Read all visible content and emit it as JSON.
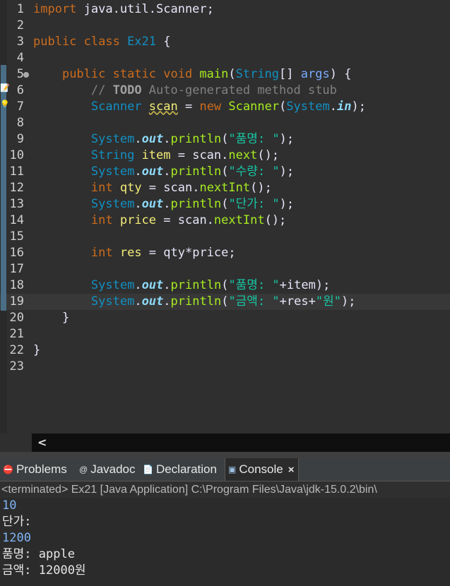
{
  "editor": {
    "lines": [
      {
        "n": "1",
        "t": [
          [
            "kw",
            "import"
          ],
          [
            "plain",
            " java.util.Scanner;"
          ]
        ]
      },
      {
        "n": "2",
        "t": []
      },
      {
        "n": "3",
        "t": [
          [
            "kw",
            "public class "
          ],
          [
            "cls",
            "Ex21"
          ],
          [
            "plain",
            " {"
          ]
        ]
      },
      {
        "n": "4",
        "t": []
      },
      {
        "n": "5",
        "t": [
          [
            "plain",
            "    "
          ],
          [
            "kw",
            "public static void "
          ],
          [
            "fn",
            "main"
          ],
          [
            "plain",
            "("
          ],
          [
            "cls",
            "String"
          ],
          [
            "plain",
            "[] "
          ],
          [
            "param",
            "args"
          ],
          [
            "plain",
            ") {"
          ]
        ]
      },
      {
        "n": "6",
        "t": [
          [
            "plain",
            "        "
          ],
          [
            "cmt",
            "// "
          ],
          [
            "todo",
            "TODO"
          ],
          [
            "cmt",
            " Auto-generated method stub"
          ]
        ]
      },
      {
        "n": "7",
        "t": [
          [
            "plain",
            "        "
          ],
          [
            "cls",
            "Scanner "
          ],
          [
            "varw",
            "scan"
          ],
          [
            "plain",
            " = "
          ],
          [
            "kw",
            "new "
          ],
          [
            "fn",
            "Scanner"
          ],
          [
            "plain",
            "("
          ],
          [
            "cls",
            "System"
          ],
          [
            "plain",
            "."
          ],
          [
            "fld",
            "in"
          ],
          [
            "plain",
            ");"
          ]
        ]
      },
      {
        "n": "8",
        "t": []
      },
      {
        "n": "9",
        "t": [
          [
            "plain",
            "        "
          ],
          [
            "cls",
            "System"
          ],
          [
            "plain",
            "."
          ],
          [
            "fld",
            "out"
          ],
          [
            "plain",
            "."
          ],
          [
            "fn",
            "println"
          ],
          [
            "plain",
            "("
          ],
          [
            "str",
            "\"품명: \""
          ],
          [
            "plain",
            ");"
          ]
        ]
      },
      {
        "n": "10",
        "t": [
          [
            "plain",
            "        "
          ],
          [
            "cls",
            "String "
          ],
          [
            "var",
            "item"
          ],
          [
            "plain",
            " = scan."
          ],
          [
            "fn",
            "next"
          ],
          [
            "plain",
            "();"
          ]
        ]
      },
      {
        "n": "11",
        "t": [
          [
            "plain",
            "        "
          ],
          [
            "cls",
            "System"
          ],
          [
            "plain",
            "."
          ],
          [
            "fld",
            "out"
          ],
          [
            "plain",
            "."
          ],
          [
            "fn",
            "println"
          ],
          [
            "plain",
            "("
          ],
          [
            "str",
            "\"수량: \""
          ],
          [
            "plain",
            ");"
          ]
        ]
      },
      {
        "n": "12",
        "t": [
          [
            "plain",
            "        "
          ],
          [
            "kw",
            "int "
          ],
          [
            "var",
            "qty"
          ],
          [
            "plain",
            " = scan."
          ],
          [
            "fn",
            "nextInt"
          ],
          [
            "plain",
            "();"
          ]
        ]
      },
      {
        "n": "13",
        "t": [
          [
            "plain",
            "        "
          ],
          [
            "cls",
            "System"
          ],
          [
            "plain",
            "."
          ],
          [
            "fld",
            "out"
          ],
          [
            "plain",
            "."
          ],
          [
            "fn",
            "println"
          ],
          [
            "plain",
            "("
          ],
          [
            "str",
            "\"단가: \""
          ],
          [
            "plain",
            ");"
          ]
        ]
      },
      {
        "n": "14",
        "t": [
          [
            "plain",
            "        "
          ],
          [
            "kw",
            "int "
          ],
          [
            "var",
            "price"
          ],
          [
            "plain",
            " = scan."
          ],
          [
            "fn",
            "nextInt"
          ],
          [
            "plain",
            "();"
          ]
        ]
      },
      {
        "n": "15",
        "t": []
      },
      {
        "n": "16",
        "t": [
          [
            "plain",
            "        "
          ],
          [
            "kw",
            "int "
          ],
          [
            "var",
            "res"
          ],
          [
            "plain",
            " = qty*price;"
          ]
        ]
      },
      {
        "n": "17",
        "t": []
      },
      {
        "n": "18",
        "t": [
          [
            "plain",
            "        "
          ],
          [
            "cls",
            "System"
          ],
          [
            "plain",
            "."
          ],
          [
            "fld",
            "out"
          ],
          [
            "plain",
            "."
          ],
          [
            "fn",
            "println"
          ],
          [
            "plain",
            "("
          ],
          [
            "str",
            "\"품명: \""
          ],
          [
            "plain",
            "+item);"
          ]
        ]
      },
      {
        "n": "19",
        "t": [
          [
            "plain",
            "        "
          ],
          [
            "cls",
            "System"
          ],
          [
            "plain",
            "."
          ],
          [
            "fld",
            "out"
          ],
          [
            "plain",
            "."
          ],
          [
            "fn",
            "println"
          ],
          [
            "plain",
            "("
          ],
          [
            "str",
            "\"금액: \""
          ],
          [
            "plain",
            "+res+"
          ],
          [
            "str",
            "\"원\""
          ],
          [
            "plain",
            ");"
          ]
        ]
      },
      {
        "n": "20",
        "t": [
          [
            "plain",
            "    }"
          ]
        ]
      },
      {
        "n": "21",
        "t": []
      },
      {
        "n": "22",
        "t": [
          [
            "plain",
            "}"
          ]
        ]
      },
      {
        "n": "23",
        "t": []
      }
    ],
    "current_line": "19"
  },
  "hscroll": {
    "arrow": "<"
  },
  "tabs": [
    {
      "label": "Problems",
      "icon": "problems-icon",
      "glyph": "⛔"
    },
    {
      "label": "Javadoc",
      "icon": "javadoc-icon",
      "glyph": "@"
    },
    {
      "label": "Declaration",
      "icon": "declaration-icon",
      "glyph": "📄"
    },
    {
      "label": "Console",
      "icon": "console-icon",
      "glyph": "▣",
      "close": "×"
    }
  ],
  "console": {
    "status": "<terminated> Ex21 [Java Application] C:\\Program Files\\Java\\jdk-15.0.2\\bin\\",
    "lines": [
      {
        "text": "10",
        "kind": "in"
      },
      {
        "text": "단가:",
        "kind": "out"
      },
      {
        "text": "1200",
        "kind": "in"
      },
      {
        "text": "품명: apple",
        "kind": "out"
      },
      {
        "text": "금액: 12000원",
        "kind": "out"
      }
    ]
  }
}
